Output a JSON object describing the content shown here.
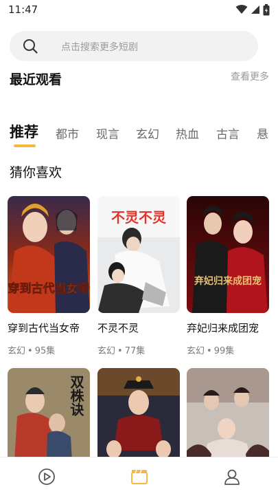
{
  "status_bar": {
    "time": "11:47"
  },
  "search": {
    "placeholder": "点击搜索更多短剧"
  },
  "recent": {
    "title": "最近观看",
    "more_label": "查看更多"
  },
  "tabs": [
    {
      "label": "推荐",
      "active": true
    },
    {
      "label": "都市"
    },
    {
      "label": "现言"
    },
    {
      "label": "玄幻"
    },
    {
      "label": "热血"
    },
    {
      "label": "古言"
    },
    {
      "label": "悬"
    }
  ],
  "section": {
    "title": "猜你喜欢"
  },
  "cards": [
    {
      "title": "穿到古代当女帝",
      "genre": "玄幻",
      "episodes": "95集",
      "poster_text": "穿到古代当女帝",
      "poster_palette": [
        "#6a1e14",
        "#d24a1c",
        "#f0b040"
      ]
    },
    {
      "title": "不灵不灵",
      "genre": "玄幻",
      "episodes": "77集",
      "poster_text": "不灵不灵",
      "poster_palette": [
        "#cfd6dc",
        "#f4f4f4",
        "#3a3a3a"
      ]
    },
    {
      "title": "弃妃归来成团宠",
      "genre": "玄幻",
      "episodes": "99集",
      "poster_text": "弃妃归来成团宠",
      "poster_palette": [
        "#3a0a0c",
        "#b0141c",
        "#e8c070"
      ]
    },
    {
      "title": "",
      "genre": "",
      "episodes": "",
      "poster_text": "双株诀",
      "poster_palette": [
        "#8a7a5a",
        "#b83a2a",
        "#3a4a6a"
      ]
    },
    {
      "title": "",
      "genre": "",
      "episodes": "",
      "poster_text": "",
      "poster_palette": [
        "#2a2a3a",
        "#c0a070",
        "#7a1a1a"
      ]
    },
    {
      "title": "",
      "genre": "",
      "episodes": "",
      "poster_text": "",
      "poster_palette": [
        "#b8b0a8",
        "#e6dcd6",
        "#4a2a2a"
      ]
    }
  ],
  "bottom_nav": [
    {
      "name": "play-icon",
      "active": false
    },
    {
      "name": "clapperboard-icon",
      "active": true
    },
    {
      "name": "profile-icon",
      "active": false
    }
  ],
  "colors": {
    "accent": "#f5b942",
    "tab_inactive": "#6a6a6a",
    "meta": "#7a7a7a",
    "search_bg": "#f2f2f2"
  }
}
